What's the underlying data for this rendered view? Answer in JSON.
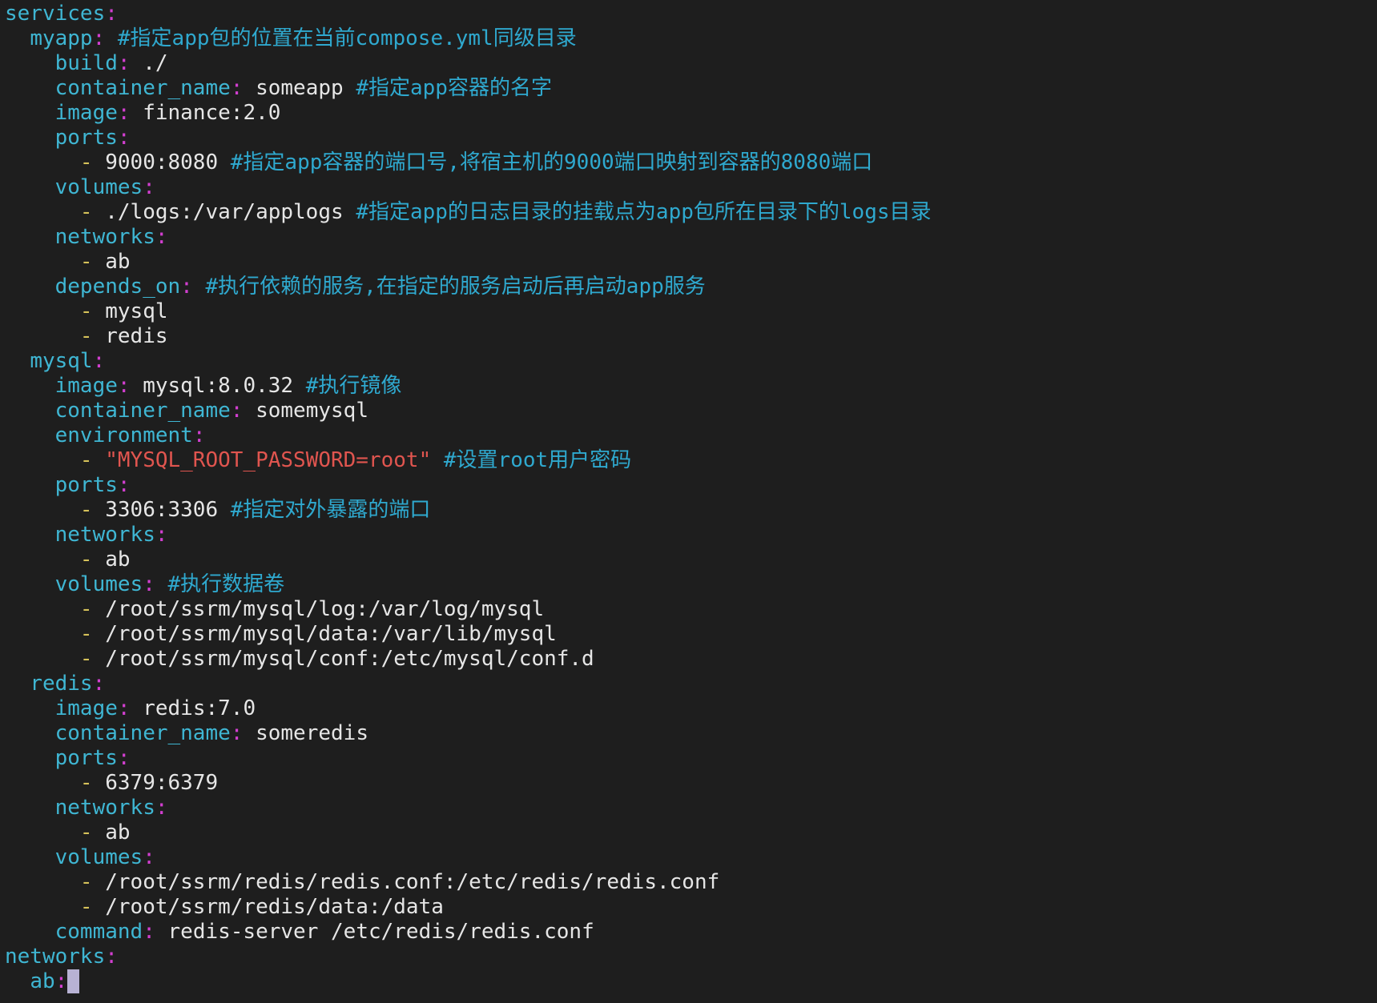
{
  "colors": {
    "background": "#1e1e1e",
    "key": "#3fb6d3",
    "punctuation": "#d23fd0",
    "value": "#e6e6e6",
    "comment": "#2fa9cf",
    "string": "#e0554f",
    "list_dash": "#d6c25a",
    "cursor": "#b8b2d4"
  },
  "cursor": {
    "line": 39,
    "after_token": 2
  },
  "lines": [
    [
      {
        "t": "services",
        "c": "key"
      },
      {
        "t": ":",
        "c": "punct"
      }
    ],
    [
      {
        "t": "  "
      },
      {
        "t": "myapp",
        "c": "key"
      },
      {
        "t": ":",
        "c": "punct"
      },
      {
        "t": " "
      },
      {
        "t": "#指定app包的位置在当前compose.yml同级目录",
        "c": "comment"
      }
    ],
    [
      {
        "t": "    "
      },
      {
        "t": "build",
        "c": "key"
      },
      {
        "t": ":",
        "c": "punct"
      },
      {
        "t": " ./",
        "c": "val"
      }
    ],
    [
      {
        "t": "    "
      },
      {
        "t": "container_name",
        "c": "key"
      },
      {
        "t": ":",
        "c": "punct"
      },
      {
        "t": " someapp ",
        "c": "val"
      },
      {
        "t": "#指定app容器的名字",
        "c": "comment"
      }
    ],
    [
      {
        "t": "    "
      },
      {
        "t": "image",
        "c": "key"
      },
      {
        "t": ":",
        "c": "punct"
      },
      {
        "t": " finance:2.0",
        "c": "val"
      }
    ],
    [
      {
        "t": "    "
      },
      {
        "t": "ports",
        "c": "key"
      },
      {
        "t": ":",
        "c": "punct"
      }
    ],
    [
      {
        "t": "      "
      },
      {
        "t": "-",
        "c": "dash"
      },
      {
        "t": " 9000:8080 ",
        "c": "val"
      },
      {
        "t": "#指定app容器的端口号,将宿主机的9000端口映射到容器的8080端口",
        "c": "comment"
      }
    ],
    [
      {
        "t": "    "
      },
      {
        "t": "volumes",
        "c": "key"
      },
      {
        "t": ":",
        "c": "punct"
      }
    ],
    [
      {
        "t": "      "
      },
      {
        "t": "-",
        "c": "dash"
      },
      {
        "t": " ./logs:/var/applogs ",
        "c": "val"
      },
      {
        "t": "#指定app的日志目录的挂载点为app包所在目录下的logs目录",
        "c": "comment"
      }
    ],
    [
      {
        "t": "    "
      },
      {
        "t": "networks",
        "c": "key"
      },
      {
        "t": ":",
        "c": "punct"
      }
    ],
    [
      {
        "t": "      "
      },
      {
        "t": "-",
        "c": "dash"
      },
      {
        "t": " ab",
        "c": "val"
      }
    ],
    [
      {
        "t": "    "
      },
      {
        "t": "depends_on",
        "c": "key"
      },
      {
        "t": ":",
        "c": "punct"
      },
      {
        "t": " "
      },
      {
        "t": "#执行依赖的服务,在指定的服务启动后再启动app服务",
        "c": "comment"
      }
    ],
    [
      {
        "t": "      "
      },
      {
        "t": "-",
        "c": "dash"
      },
      {
        "t": " mysql",
        "c": "val"
      }
    ],
    [
      {
        "t": "      "
      },
      {
        "t": "-",
        "c": "dash"
      },
      {
        "t": " redis",
        "c": "val"
      }
    ],
    [
      {
        "t": "  "
      },
      {
        "t": "mysql",
        "c": "key"
      },
      {
        "t": ":",
        "c": "punct"
      }
    ],
    [
      {
        "t": "    "
      },
      {
        "t": "image",
        "c": "key"
      },
      {
        "t": ":",
        "c": "punct"
      },
      {
        "t": " mysql:8.0.32 ",
        "c": "val"
      },
      {
        "t": "#执行镜像",
        "c": "comment"
      }
    ],
    [
      {
        "t": "    "
      },
      {
        "t": "container_name",
        "c": "key"
      },
      {
        "t": ":",
        "c": "punct"
      },
      {
        "t": " somemysql",
        "c": "val"
      }
    ],
    [
      {
        "t": "    "
      },
      {
        "t": "environment",
        "c": "key"
      },
      {
        "t": ":",
        "c": "punct"
      }
    ],
    [
      {
        "t": "      "
      },
      {
        "t": "-",
        "c": "dash"
      },
      {
        "t": " "
      },
      {
        "t": "\"MYSQL_ROOT_PASSWORD=root\"",
        "c": "string"
      },
      {
        "t": " "
      },
      {
        "t": "#设置root用户密码",
        "c": "comment"
      }
    ],
    [
      {
        "t": "    "
      },
      {
        "t": "ports",
        "c": "key"
      },
      {
        "t": ":",
        "c": "punct"
      }
    ],
    [
      {
        "t": "      "
      },
      {
        "t": "-",
        "c": "dash"
      },
      {
        "t": " 3306:3306 ",
        "c": "val"
      },
      {
        "t": "#指定对外暴露的端口",
        "c": "comment"
      }
    ],
    [
      {
        "t": "    "
      },
      {
        "t": "networks",
        "c": "key"
      },
      {
        "t": ":",
        "c": "punct"
      }
    ],
    [
      {
        "t": "      "
      },
      {
        "t": "-",
        "c": "dash"
      },
      {
        "t": " ab",
        "c": "val"
      }
    ],
    [
      {
        "t": "    "
      },
      {
        "t": "volumes",
        "c": "key"
      },
      {
        "t": ":",
        "c": "punct"
      },
      {
        "t": " "
      },
      {
        "t": "#执行数据卷",
        "c": "comment"
      }
    ],
    [
      {
        "t": "      "
      },
      {
        "t": "-",
        "c": "dash"
      },
      {
        "t": " /root/ssrm/mysql/log:/var/log/mysql",
        "c": "val"
      }
    ],
    [
      {
        "t": "      "
      },
      {
        "t": "-",
        "c": "dash"
      },
      {
        "t": " /root/ssrm/mysql/data:/var/lib/mysql",
        "c": "val"
      }
    ],
    [
      {
        "t": "      "
      },
      {
        "t": "-",
        "c": "dash"
      },
      {
        "t": " /root/ssrm/mysql/conf:/etc/mysql/conf.d",
        "c": "val"
      }
    ],
    [
      {
        "t": "  "
      },
      {
        "t": "redis",
        "c": "key"
      },
      {
        "t": ":",
        "c": "punct"
      }
    ],
    [
      {
        "t": "    "
      },
      {
        "t": "image",
        "c": "key"
      },
      {
        "t": ":",
        "c": "punct"
      },
      {
        "t": " redis:7.0",
        "c": "val"
      }
    ],
    [
      {
        "t": "    "
      },
      {
        "t": "container_name",
        "c": "key"
      },
      {
        "t": ":",
        "c": "punct"
      },
      {
        "t": " someredis",
        "c": "val"
      }
    ],
    [
      {
        "t": "    "
      },
      {
        "t": "ports",
        "c": "key"
      },
      {
        "t": ":",
        "c": "punct"
      }
    ],
    [
      {
        "t": "      "
      },
      {
        "t": "-",
        "c": "dash"
      },
      {
        "t": " 6379:6379",
        "c": "val"
      }
    ],
    [
      {
        "t": "    "
      },
      {
        "t": "networks",
        "c": "key"
      },
      {
        "t": ":",
        "c": "punct"
      }
    ],
    [
      {
        "t": "      "
      },
      {
        "t": "-",
        "c": "dash"
      },
      {
        "t": " ab",
        "c": "val"
      }
    ],
    [
      {
        "t": "    "
      },
      {
        "t": "volumes",
        "c": "key"
      },
      {
        "t": ":",
        "c": "punct"
      }
    ],
    [
      {
        "t": "      "
      },
      {
        "t": "-",
        "c": "dash"
      },
      {
        "t": " /root/ssrm/redis/redis.conf:/etc/redis/redis.conf",
        "c": "val"
      }
    ],
    [
      {
        "t": "      "
      },
      {
        "t": "-",
        "c": "dash"
      },
      {
        "t": " /root/ssrm/redis/data:/data",
        "c": "val"
      }
    ],
    [
      {
        "t": "    "
      },
      {
        "t": "command",
        "c": "key"
      },
      {
        "t": ":",
        "c": "punct"
      },
      {
        "t": " redis-server /etc/redis/redis.conf",
        "c": "val"
      }
    ],
    [
      {
        "t": "networks",
        "c": "key"
      },
      {
        "t": ":",
        "c": "punct"
      }
    ],
    [
      {
        "t": "  "
      },
      {
        "t": "ab",
        "c": "key"
      },
      {
        "t": ":",
        "c": "punct"
      }
    ]
  ]
}
